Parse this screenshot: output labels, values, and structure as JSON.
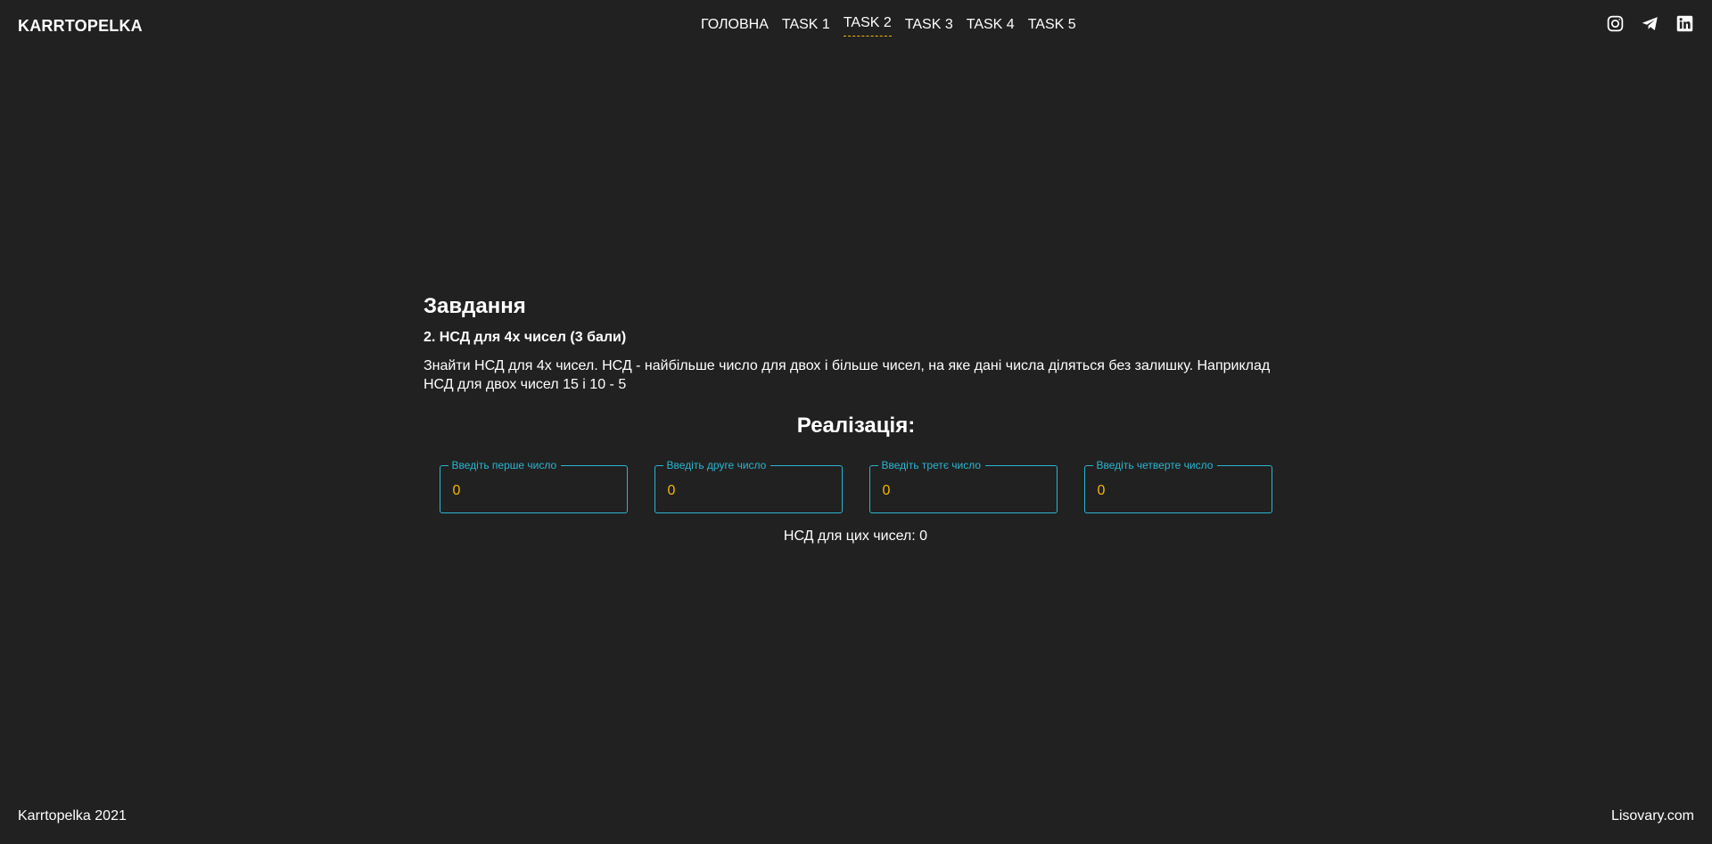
{
  "header": {
    "logo": "KARRTOPELKA",
    "nav": [
      {
        "label": "ГОЛОВНА",
        "active": false
      },
      {
        "label": "TASK 1",
        "active": false
      },
      {
        "label": "TASK 2",
        "active": true
      },
      {
        "label": "TASK 3",
        "active": false
      },
      {
        "label": "TASK 4",
        "active": false
      },
      {
        "label": "TASK 5",
        "active": false
      }
    ],
    "social_icons": [
      "instagram-icon",
      "telegram-icon",
      "linkedin-icon"
    ]
  },
  "main": {
    "title": "Завдання",
    "subtitle": "2. НСД для 4х чисел (3 бали)",
    "description": "Знайти НСД для 4х чисел. НСД - найбільше число для двох і більше чисел, на яке дані числа діляться без залишку. Наприклад НСД для двох чисел 15 і 10 - 5",
    "impl_title": "Реалізація:",
    "fields": [
      {
        "label": "Введіть перше число",
        "value": "0"
      },
      {
        "label": "Введіть друге число",
        "value": "0"
      },
      {
        "label": "Введіть третє число",
        "value": "0"
      },
      {
        "label": "Введіть четверте число",
        "value": "0"
      }
    ],
    "result": "НСД для цих чисел: 0"
  },
  "footer": {
    "left": "Karrtopelka 2021",
    "right": "Lisovary.com"
  },
  "colors": {
    "background": "#212121",
    "accent": "#29b6d1",
    "value": "#f5b800",
    "text": "#ffffff"
  }
}
